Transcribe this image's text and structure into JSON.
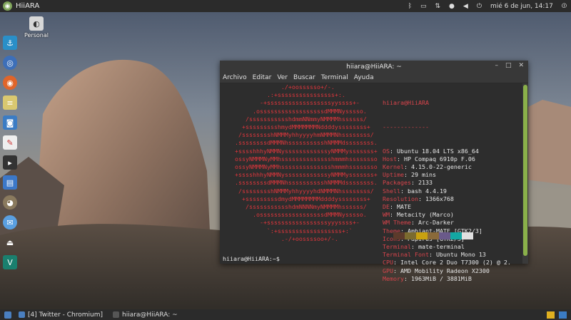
{
  "top_panel": {
    "app_title": "HiiARA",
    "datetime": "mié  6 de jun, 14:17"
  },
  "desktop": {
    "home_label": "Personal"
  },
  "dock": {
    "items": [
      "anchor-icon",
      "chromium-icon",
      "firefox-icon",
      "notes-icon",
      "camera-icon",
      "document-icon",
      "terminal-icon",
      "writer-icon",
      "gimp-icon",
      "thunderbird-icon",
      "eject-icon",
      "vectr-icon"
    ]
  },
  "terminal": {
    "title": "hiiara@HiiARA: ~",
    "menu": [
      "Archivo",
      "Editar",
      "Ver",
      "Buscar",
      "Terminal",
      "Ayuda"
    ],
    "prompt": "hiiara@HiiARA:~$",
    "logo_lines": [
      "                ./+oossssso+/-.",
      "            .:+ssssssssssssssss+:.",
      "          -+ssssssssssssssssssyyssss+-",
      "        .ossssssssssssssssssdMMMNysssso.",
      "      /ssssssssssshdmmNNmmyNMMMMhssssss/",
      "     +ssssssssshmydMMMMMMMNddddyssssssss+",
      "    /sssssssshNMMMyhhyyyyhmNMMMNhssssssss/",
      "   .ssssssssdMMMNhsssssssssshNMMMdssssssss.",
      "   +sssshhhyNMMNyssssssssssssyNMMMysssssss+",
      "   ossyNMMMNyMMhsssssssssssssshmmmhssssssso",
      "   ossyNMMMNyMMhsssssssssssssshmmmhssssssso",
      "   +sssshhhyNMMNyssssssssssssyNMMMysssssss+",
      "   .ssssssssdMMMNhsssssssssshNMMMdssssssss.",
      "    /sssssssshNMMMyhhyyyyhdNMMMNhssssssss/",
      "     +sssssssssdmydMMMMMMMMddddyssssssss+",
      "      /ssssssssssshdmNNNNmyNMMMMhssssss/",
      "        .ossssssssssssssssssdMMMNysssso.",
      "          -+sssssssssssssssssyyyssss+-",
      "            `:+ssssssssssssssssss+:`",
      "                .-/+oossssoo+/-."
    ],
    "info": {
      "header": "hiiara@HiiARA",
      "separator": "-------------",
      "rows": [
        {
          "key": "OS",
          "value": "Ubuntu 18.04 LTS x86_64"
        },
        {
          "key": "Host",
          "value": "HP Compaq 6910p F.06"
        },
        {
          "key": "Kernel",
          "value": "4.15.0-22-generic"
        },
        {
          "key": "Uptime",
          "value": "29 mins"
        },
        {
          "key": "Packages",
          "value": "2133"
        },
        {
          "key": "Shell",
          "value": "bash 4.4.19"
        },
        {
          "key": "Resolution",
          "value": "1366x768"
        },
        {
          "key": "DE",
          "value": "MATE"
        },
        {
          "key": "WM",
          "value": "Metacity (Marco)"
        },
        {
          "key": "WM Theme",
          "value": "Arc-Darker"
        },
        {
          "key": "Theme",
          "value": "Ambiant-MATE [GTK2/3]"
        },
        {
          "key": "Icons",
          "value": "Papirus [GTK2/3]"
        },
        {
          "key": "Terminal",
          "value": "mate-terminal"
        },
        {
          "key": "Terminal Font",
          "value": "Ubuntu Mono 13"
        },
        {
          "key": "CPU",
          "value": "Intel Core 2 Duo T7300 (2) @ 2."
        },
        {
          "key": "GPU",
          "value": "AMD Mobility Radeon X2300"
        },
        {
          "key": "Memory",
          "value": "1963MiB / 3881MiB"
        }
      ]
    },
    "swatch_colors": [
      "#5c3a2b",
      "#7b6b2f",
      "#c8a10f",
      "#8a6a3a",
      "#6a5a8a",
      "#13a7a3",
      "#e0e0e0"
    ]
  },
  "taskbar": {
    "tasks": [
      {
        "label": "[4] Twitter - Chromium]",
        "color": "#4a7fc0"
      },
      {
        "label": "hiiara@HiiARA: ~",
        "color": "#555"
      }
    ]
  }
}
